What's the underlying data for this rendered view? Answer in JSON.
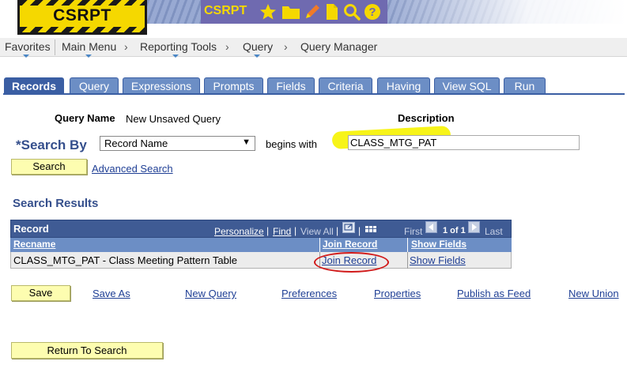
{
  "header": {
    "logo_text": "CSRPT",
    "app_title": "CSRPT",
    "icons": [
      "star-icon",
      "folder-icon",
      "pencil-icon",
      "document-icon",
      "search-icon",
      "help-icon"
    ]
  },
  "breadcrumb": {
    "favorites": "Favorites",
    "main_menu": "Main Menu",
    "reporting_tools": "Reporting Tools",
    "query": "Query",
    "query_manager": "Query Manager",
    "separator": "›"
  },
  "tabs": [
    {
      "label": "Records",
      "active": true
    },
    {
      "label": "Query"
    },
    {
      "label": "Expressions"
    },
    {
      "label": "Prompts"
    },
    {
      "label": "Fields"
    },
    {
      "label": "Criteria"
    },
    {
      "label": "Having"
    },
    {
      "label": "View SQL"
    },
    {
      "label": "Run"
    }
  ],
  "form": {
    "query_name_label": "Query Name",
    "query_name_value": "New Unsaved Query",
    "description_label": "Description",
    "search_by_label": "*Search By",
    "search_by_value": "Record Name",
    "begins_with_label": "begins with",
    "description_input": "CLASS_MTG_PAT",
    "search_button": "Search",
    "advanced_search": "Advanced Search"
  },
  "results": {
    "title": "Search Results",
    "grid_title": "Record",
    "personalize": "Personalize",
    "find": "Find",
    "view_all": "View All",
    "first": "First",
    "count": "1 of 1",
    "last": "Last",
    "pipe": "|",
    "columns": [
      "Recname",
      "Join Record",
      "Show Fields"
    ],
    "rows": [
      {
        "recname": "CLASS_MTG_PAT - Class Meeting Pattern Table",
        "join": "Join Record",
        "show": "Show Fields"
      }
    ]
  },
  "actions": {
    "save": "Save",
    "save_as": "Save As",
    "new_query": "New Query",
    "preferences": "Preferences",
    "properties": "Properties",
    "publish_as_feed": "Publish as Feed",
    "new_union": "New Union",
    "return_to_search": "Return To Search"
  },
  "colors": {
    "tab_active": "#3a5ea3",
    "tab": "#6c8ec5",
    "button_yellow": "#fdfdb0",
    "link": "#1f3f95",
    "highlight": "#f6f300",
    "annotation_circle": "#d11a1a"
  }
}
